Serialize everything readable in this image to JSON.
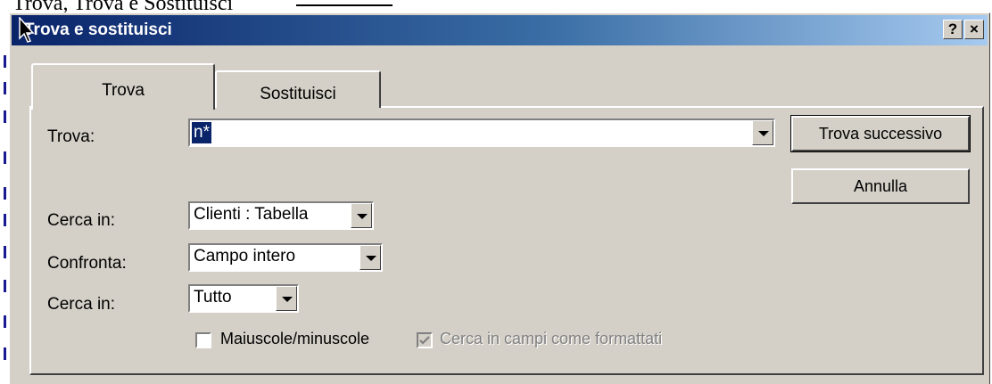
{
  "page_caption": "Trova, Trova e Sostituisci",
  "window": {
    "title": "Trova e sostituisci",
    "help_button": "?",
    "close_button": "×"
  },
  "tabs": [
    {
      "label": "Trova",
      "active": true
    },
    {
      "label": "Sostituisci",
      "active": false
    }
  ],
  "form": {
    "find_label": "Trova:",
    "find_value": "n*",
    "look_in_label": "Cerca in:",
    "look_in_value": "Clienti : Tabella",
    "match_label": "Confronta:",
    "match_value": "Campo intero",
    "search_label": "Cerca in:",
    "search_value": "Tutto",
    "match_case_label": "Maiuscole/minuscole",
    "match_case_checked": false,
    "search_formatted_label": "Cerca in campi come formattati",
    "search_formatted_checked": true,
    "search_formatted_enabled": false
  },
  "buttons": {
    "find_next": "Trova successivo",
    "cancel": "Annulla"
  }
}
